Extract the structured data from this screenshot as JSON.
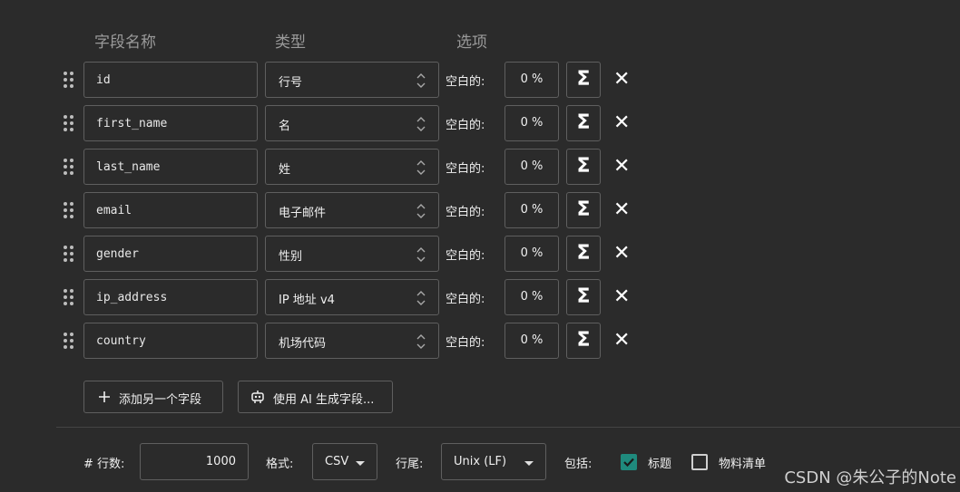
{
  "headers": {
    "field_name": "字段名称",
    "type": "类型",
    "options": "选项"
  },
  "rows": [
    {
      "name": "id",
      "type": "行号",
      "blank_label": "空白的:",
      "blank_pct": "0 %"
    },
    {
      "name": "first_name",
      "type": "名",
      "blank_label": "空白的:",
      "blank_pct": "0 %"
    },
    {
      "name": "last_name",
      "type": "姓",
      "blank_label": "空白的:",
      "blank_pct": "0 %"
    },
    {
      "name": "email",
      "type": "电子邮件",
      "blank_label": "空白的:",
      "blank_pct": "0 %"
    },
    {
      "name": "gender",
      "type": "性别",
      "blank_label": "空白的:",
      "blank_pct": "0 %"
    },
    {
      "name": "ip_address",
      "type": "IP 地址 v4",
      "blank_label": "空白的:",
      "blank_pct": "0 %"
    },
    {
      "name": "country",
      "type": "机场代码",
      "blank_label": "空白的:",
      "blank_pct": "0 %"
    }
  ],
  "row_icons": {
    "drag": "drag-handle-icon",
    "formula": "sigma-icon",
    "remove": "close-icon"
  },
  "buttons": {
    "add_field": {
      "label": "添加另一个字段",
      "icon": "plus-icon"
    },
    "ai_generate": {
      "label": "使用 AI 生成字段...",
      "icon": "robot-icon"
    }
  },
  "footer": {
    "rows_label": "# 行数:",
    "rows_value": "1000",
    "format_label": "格式:",
    "format_value": "CSV",
    "line_ending_label": "行尾:",
    "line_ending_value": "Unix (LF)",
    "include_label": "包括:",
    "include_header": {
      "label": "标题",
      "checked": true
    },
    "include_bom": {
      "label": "物料清单",
      "checked": false
    }
  },
  "watermark": "CSDN @朱公子的Note",
  "colors": {
    "background": "#2b2b2b",
    "border": "#5f5f5f",
    "checkbox_accent": "#1f8a7d"
  }
}
